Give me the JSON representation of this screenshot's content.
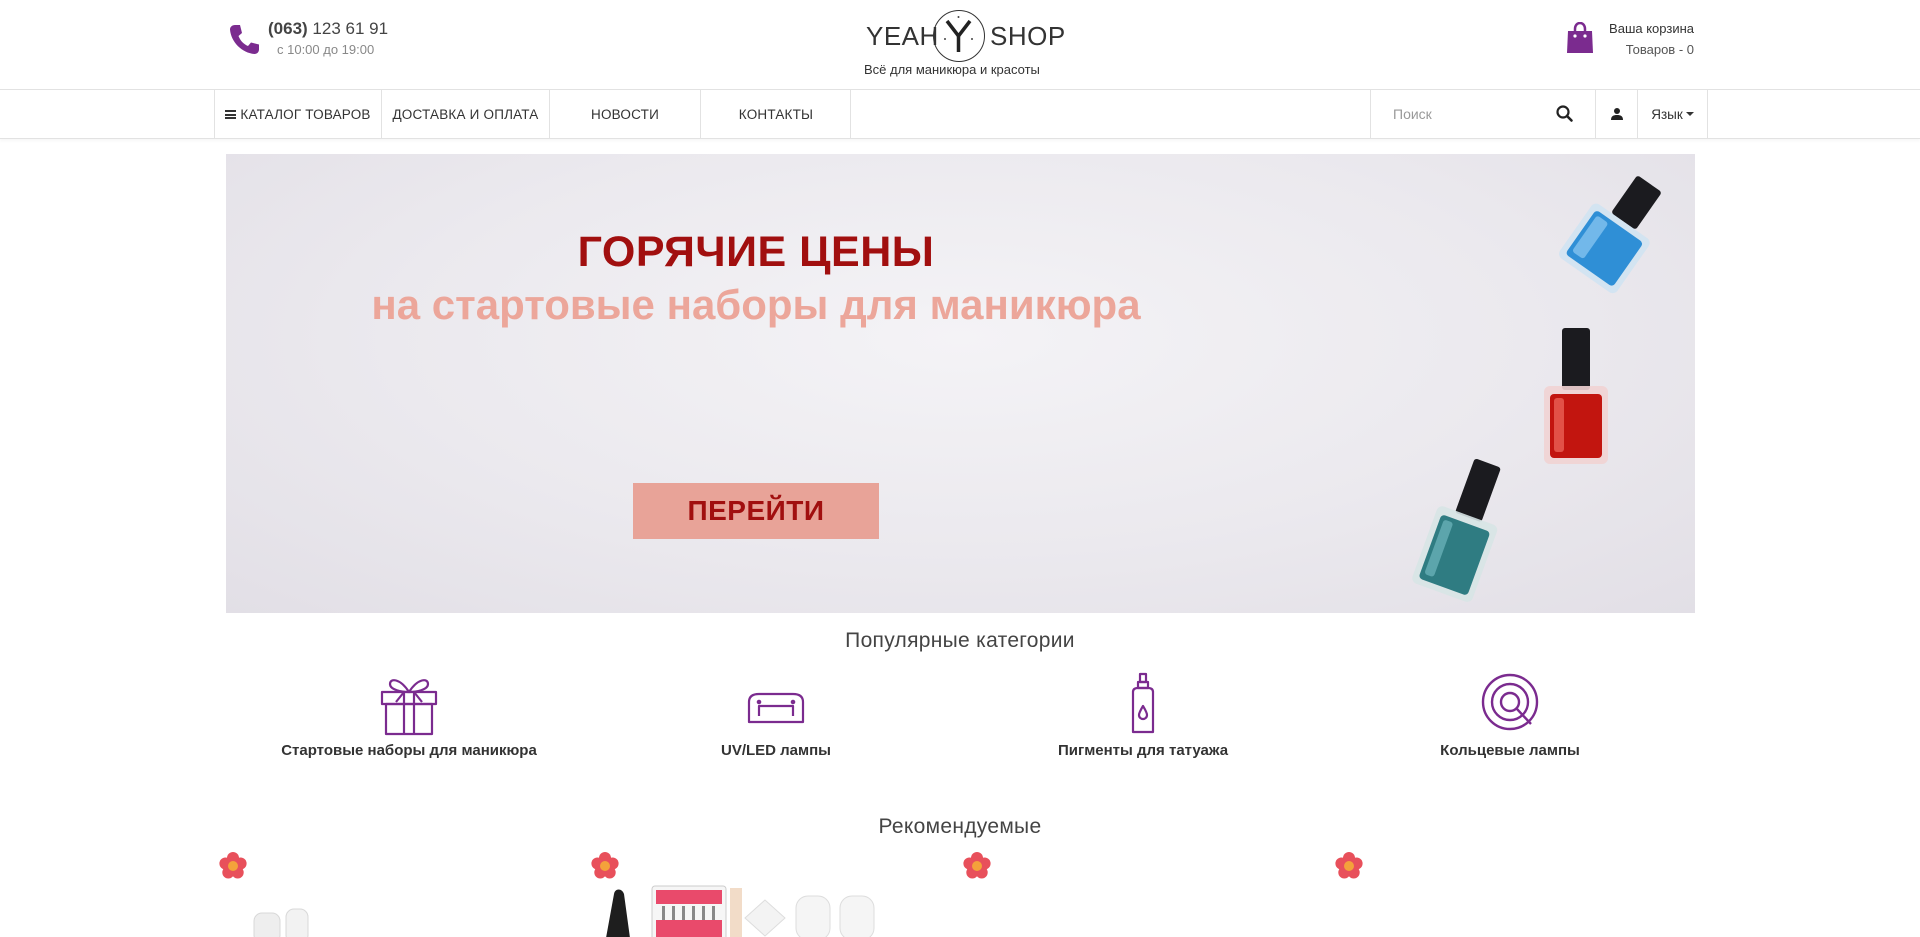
{
  "header": {
    "phone_code": "(063)",
    "phone_number": "123 61 91",
    "hours": "с 10:00 до 19:00",
    "logo_left": "YEAH",
    "logo_right": "SHOP",
    "tagline": "Всё для маникюра и красоты",
    "cart_title": "Ваша корзина",
    "cart_count": "Товаров - 0",
    "accent_color": "#7b2b8f"
  },
  "nav": {
    "items": [
      {
        "label": "КАТАЛОГ ТОВАРОВ"
      },
      {
        "label": "ДОСТАВКА И ОПЛАТА"
      },
      {
        "label": "НОВОСТИ"
      },
      {
        "label": "КОНТАКТЫ"
      }
    ],
    "search_placeholder": "Поиск",
    "language_label": "Язык"
  },
  "banner": {
    "title": "ГОРЯЧИЕ ЦЕНЫ",
    "subtitle": "на стартовые наборы для маникюра",
    "button_label": "ПЕРЕЙТИ",
    "title_color": "#a10f0f",
    "subtitle_color": "#eca69a"
  },
  "popular": {
    "title": "Популярные категории",
    "categories": [
      {
        "label": "Стартовые наборы для маникюра",
        "icon": "gift-icon"
      },
      {
        "label": "UV/LED лампы",
        "icon": "lamp-icon"
      },
      {
        "label": "Пигменты для татуажа",
        "icon": "bottle-icon"
      },
      {
        "label": "Кольцевые лампы",
        "icon": "ring-lamp-icon"
      }
    ]
  },
  "recommended": {
    "title": "Рекомендуемые",
    "rating_stars": "★★★★★"
  }
}
